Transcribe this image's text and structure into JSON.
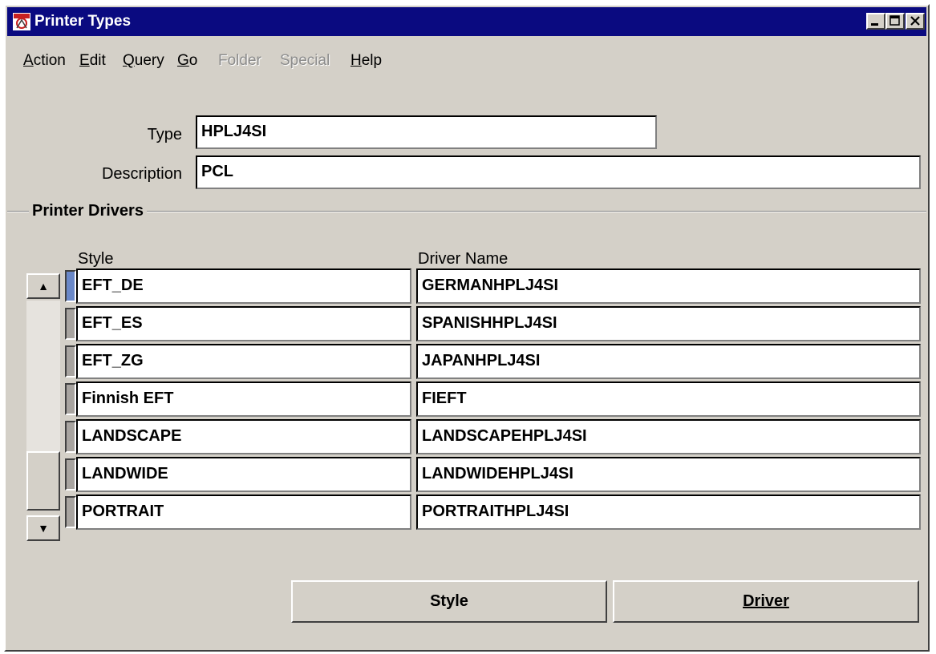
{
  "window": {
    "title": "Printer Types"
  },
  "menu": [
    {
      "label": "Action",
      "enabled": true
    },
    {
      "label": "Edit",
      "enabled": true
    },
    {
      "label": "Query",
      "enabled": true
    },
    {
      "label": "Go",
      "enabled": true
    },
    {
      "label": "Folder",
      "enabled": false
    },
    {
      "label": "Special",
      "enabled": false
    },
    {
      "label": "Help",
      "enabled": true
    }
  ],
  "form": {
    "type_label": "Type",
    "type_value": "HPLJ4SI",
    "description_label": "Description",
    "description_value": "PCL"
  },
  "drivers": {
    "group_title": "Printer Drivers",
    "col_style": "Style",
    "col_driver": "Driver Name",
    "rows": [
      {
        "style": "EFT_DE",
        "driver": "GERMANHPLJ4SI"
      },
      {
        "style": "EFT_ES",
        "driver": "SPANISHHPLJ4SI"
      },
      {
        "style": "EFT_ZG",
        "driver": "JAPANHPLJ4SI"
      },
      {
        "style": "Finnish EFT",
        "driver": "FIEFT"
      },
      {
        "style": "LANDSCAPE",
        "driver": "LANDSCAPEHPLJ4SI"
      },
      {
        "style": "LANDWIDE",
        "driver": "LANDWIDEHPLJ4SI"
      },
      {
        "style": "PORTRAIT",
        "driver": "PORTRAITHPLJ4SI"
      }
    ]
  },
  "buttons": {
    "style": "Style",
    "driver": "Driver"
  },
  "colors": {
    "titlebar": "#0a0a80",
    "window_bg": "#d4d0c8",
    "active_row": "#6a88c8"
  }
}
